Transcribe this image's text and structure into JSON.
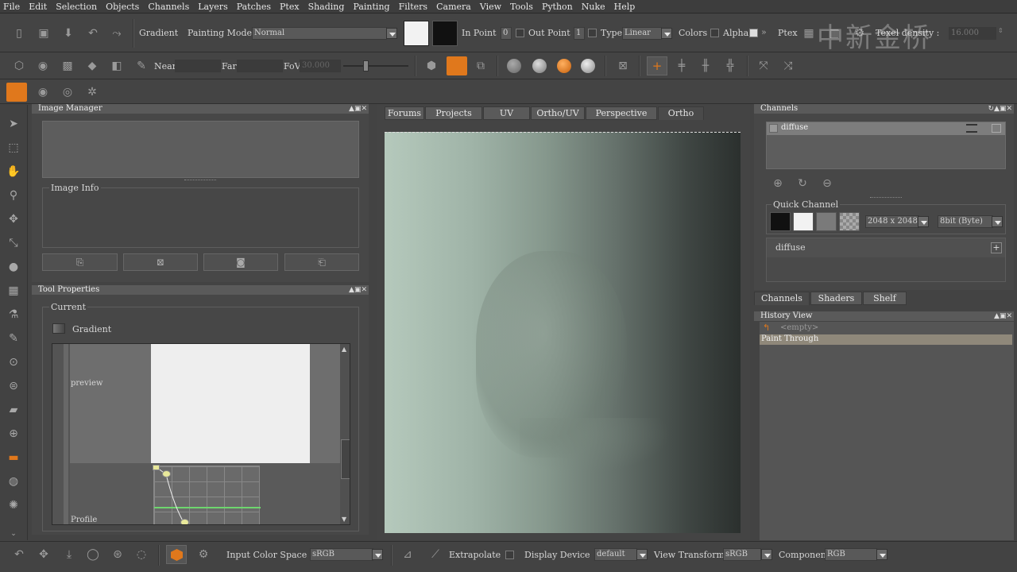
{
  "menu": [
    "File",
    "Edit",
    "Selection",
    "Objects",
    "Channels",
    "Layers",
    "Patches",
    "Ptex",
    "Shading",
    "Painting",
    "Filters",
    "Camera",
    "View",
    "Tools",
    "Python",
    "Nuke",
    "Help"
  ],
  "toolbar1": {
    "gradient_label": "Gradient",
    "painting_mode_label": "Painting Mode",
    "painting_mode_value": "Normal",
    "in_point_label": "In Point",
    "in_point_value": "0",
    "out_point_label": "Out Point",
    "out_point_value": "1",
    "type_label": "Type",
    "type_value": "Linear",
    "colors_label": "Colors",
    "alpha_label": "Alpha",
    "ptex_label": "Ptex",
    "texel_density_label": "Texel density :",
    "texel_density_value": "16.000"
  },
  "toolbar2": {
    "near_label": "Near",
    "far_label": "Far",
    "fov_label": "FoV",
    "fov_value": "30.000"
  },
  "watermark": "中新金桥",
  "image_manager": {
    "title": "Image Manager",
    "image_info_label": "Image Info"
  },
  "tool_properties": {
    "title": "Tool Properties",
    "current_label": "Current",
    "tool_name": "Gradient",
    "preview_label": "preview",
    "profile_label": "Profile"
  },
  "viewport_tabs": [
    "Forums",
    "Projects",
    "UV",
    "Ortho/UV",
    "Perspective",
    "Ortho"
  ],
  "channels": {
    "title": "Channels",
    "channel_item": "diffuse",
    "quick_channel_label": "Quick Channel",
    "size_value": "2048 x 2048",
    "depth_value": "8bit  (Byte)",
    "layer_name": "diffuse",
    "bottom_tabs": [
      "Channels",
      "Shaders",
      "Shelf"
    ]
  },
  "history": {
    "title": "History View",
    "items": [
      "<empty>",
      "Paint Through"
    ]
  },
  "bottombar": {
    "input_color_space_label": "Input Color Space",
    "input_color_space_value": "sRGB",
    "extrapolate_label": "Extrapolate",
    "display_device_label": "Display Device",
    "display_device_value": "default",
    "view_transform_label": "View Transform",
    "view_transform_value": "sRGB",
    "component_label": "Component",
    "component_value": "RGB"
  },
  "colors": {
    "accent": "#e0781c",
    "swatch_white": "#f2f2f2",
    "swatch_black": "#111111"
  }
}
